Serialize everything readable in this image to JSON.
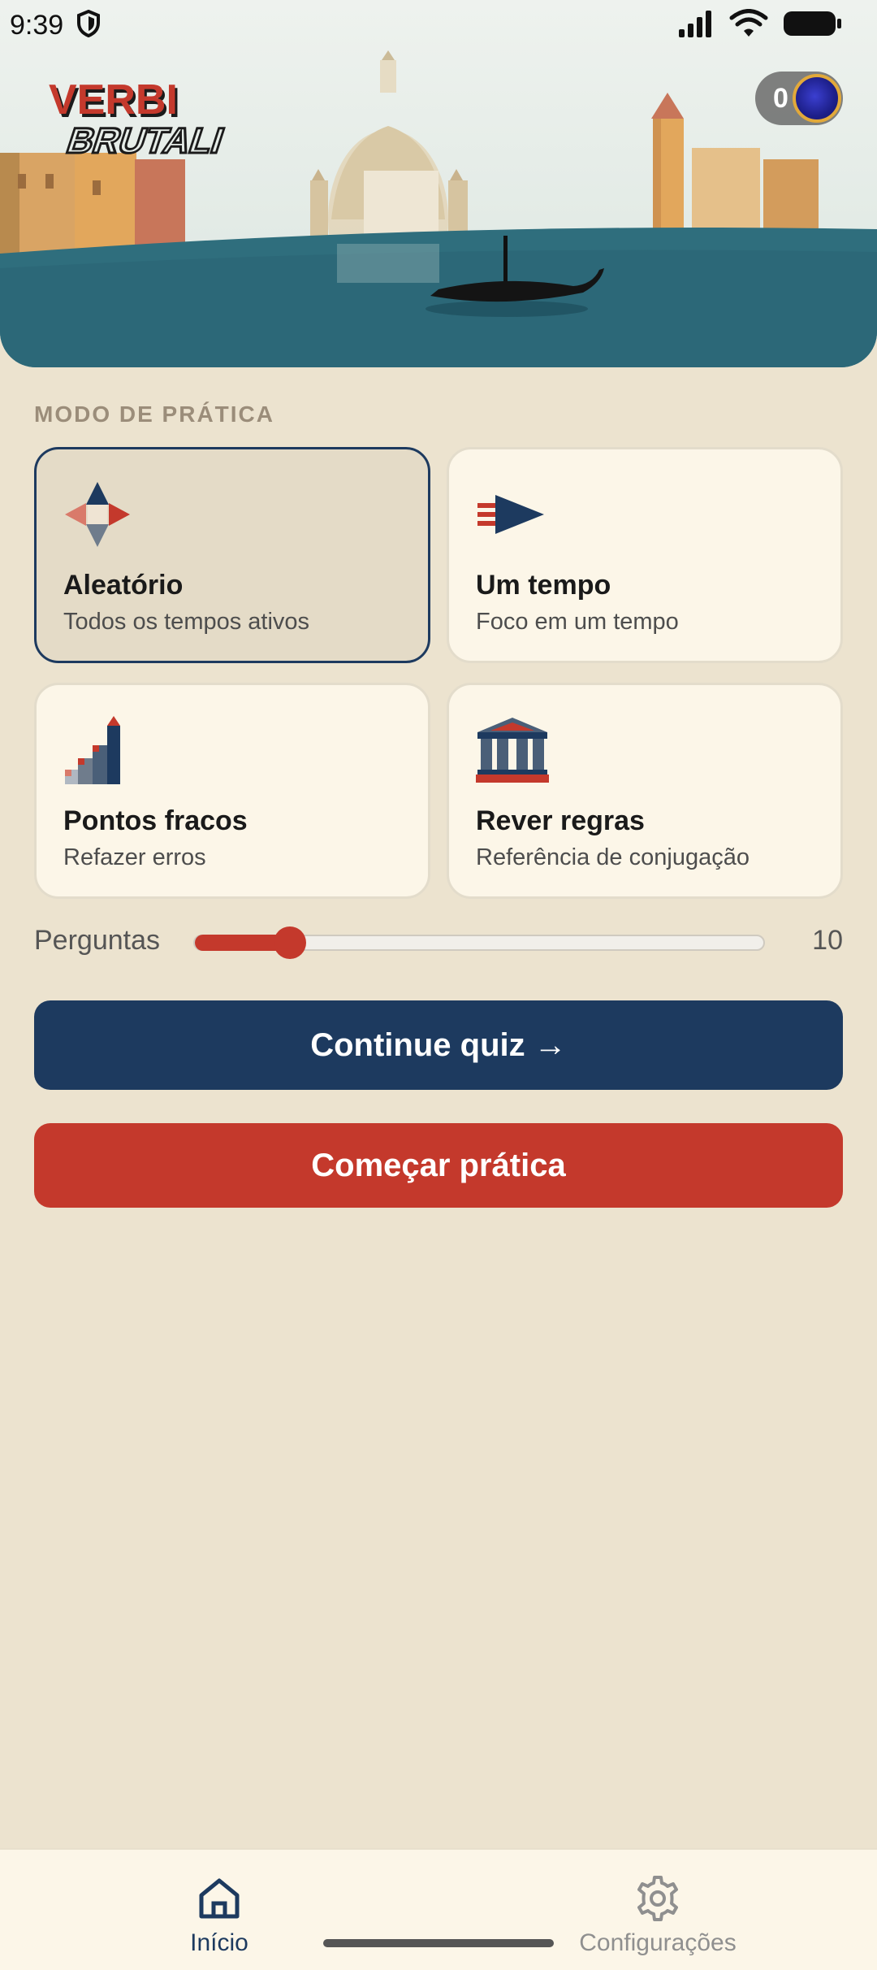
{
  "status_bar": {
    "time": "9:39"
  },
  "header": {
    "app_name": "VERBI BRUTALI",
    "coin_count": "0"
  },
  "section_label": "MODO DE PRÁTICA",
  "modes": [
    {
      "title": "Aleatório",
      "subtitle": "Todos os tempos ativos",
      "icon": "compass-icon",
      "selected": true
    },
    {
      "title": "Um tempo",
      "subtitle": "Foco em um tempo",
      "icon": "arrow-flag-icon",
      "selected": false
    },
    {
      "title": "Pontos fracos",
      "subtitle": "Refazer erros",
      "icon": "stairs-icon",
      "selected": false
    },
    {
      "title": "Rever regras",
      "subtitle": "Referência de conjugação",
      "icon": "temple-icon",
      "selected": false
    }
  ],
  "questions": {
    "label": "Perguntas",
    "value": "10",
    "fraction": 0.1667
  },
  "buttons": {
    "continue": "Continue quiz →",
    "start": "Começar prática"
  },
  "nav": {
    "home": "Início",
    "settings": "Configurações"
  },
  "colors": {
    "navy": "#1d3a5f",
    "red": "#c4392c",
    "background": "#ece3cf",
    "card": "#fcf6e8"
  }
}
